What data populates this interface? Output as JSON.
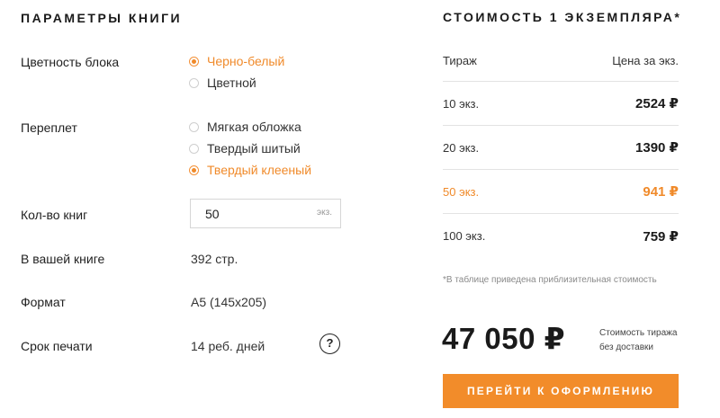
{
  "params": {
    "title": "ПАРАМЕТРЫ КНИГИ",
    "color_label": "Цветность блока",
    "color_options": [
      "Черно-белый",
      "Цветной"
    ],
    "color_selected": "Черно-белый",
    "binding_label": "Переплет",
    "binding_options": [
      "Мягкая обложка",
      "Твердый шитый",
      "Твердый клееный"
    ],
    "binding_selected": "Твердый клееный",
    "quantity_label": "Кол-во книг",
    "quantity_value": "50",
    "quantity_unit": "экз.",
    "pages_label": "В вашей книге",
    "pages_value": "392 стр.",
    "format_label": "Формат",
    "format_value": "А5 (145х205)",
    "print_time_label": "Срок печати",
    "print_time_value": "14 реб. дней",
    "help_symbol": "?"
  },
  "cost": {
    "title": "СТОИМОСТЬ 1 ЭКЗЕМПЛЯРА*",
    "col_run": "Тираж",
    "col_price": "Цена за экз.",
    "rows": [
      {
        "qty": "10 экз.",
        "price": "2524 ₽",
        "highlighted": false
      },
      {
        "qty": "20 экз.",
        "price": "1390 ₽",
        "highlighted": false
      },
      {
        "qty": "50 экз.",
        "price": "941 ₽",
        "highlighted": true
      },
      {
        "qty": "100 экз.",
        "price": "759 ₽",
        "highlighted": false
      }
    ],
    "footnote": "*В таблице приведена приблизительная стоимость",
    "total": "47 050 ₽",
    "total_note_line1": "Стоимость тиража",
    "total_note_line2": "без доставки",
    "cta_label": "ПЕРЕЙТИ К ОФОРМЛЕНИЮ"
  },
  "colors": {
    "accent": "#f08a2a",
    "text": "#222222",
    "muted": "#8a8a8a"
  }
}
